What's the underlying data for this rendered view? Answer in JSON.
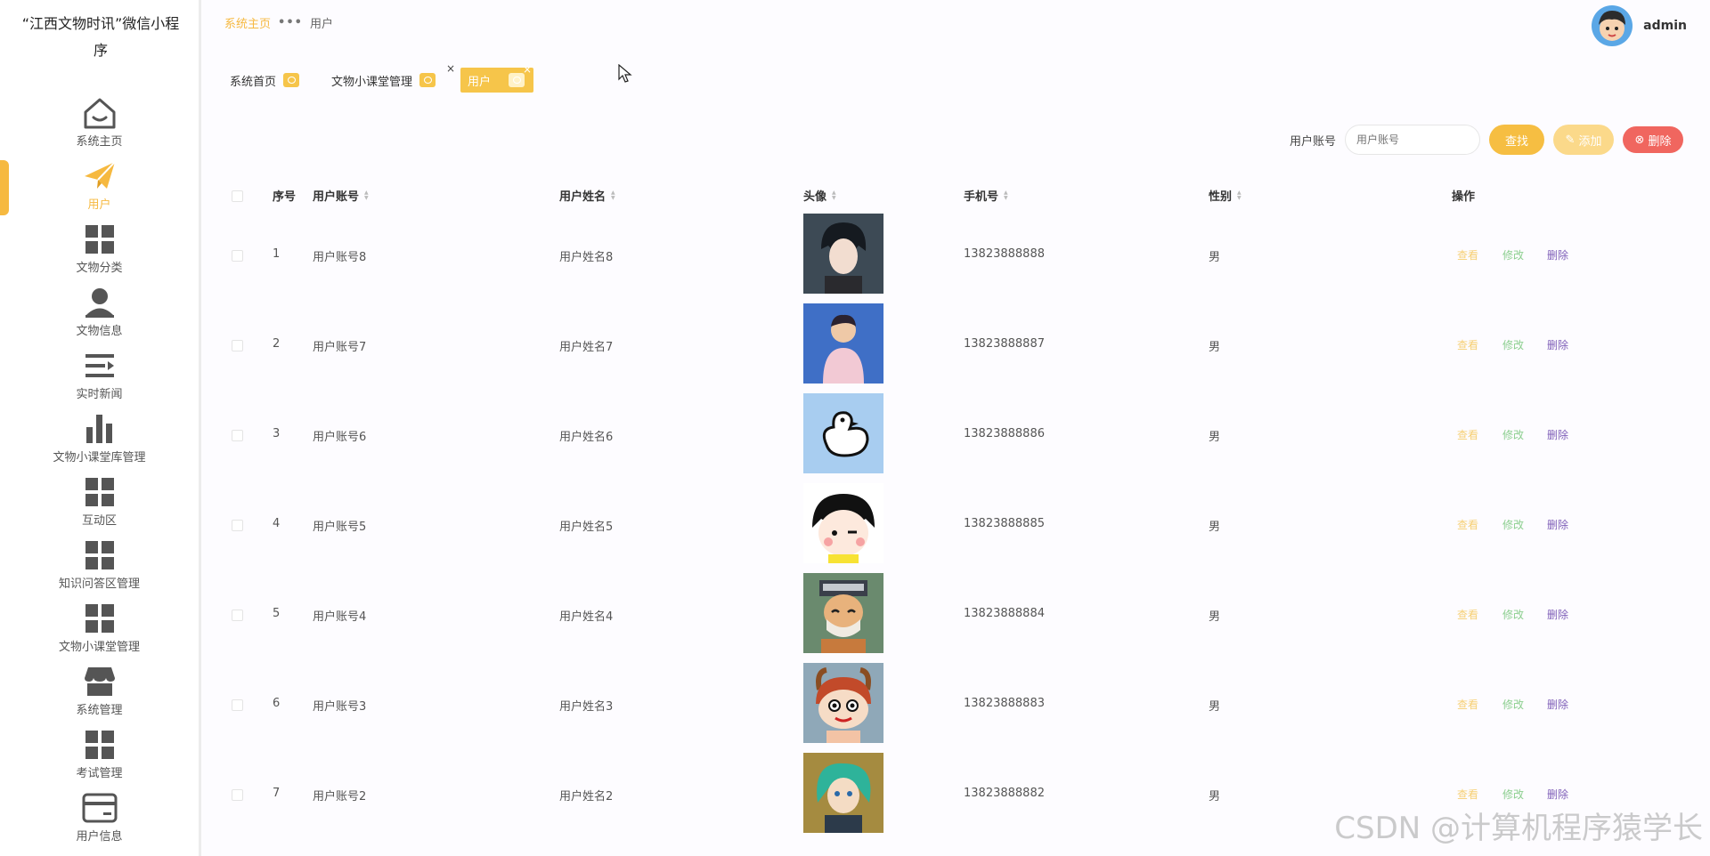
{
  "app": {
    "title": "“江西文物时讯”微信小程序"
  },
  "sidebar": {
    "items": [
      {
        "label": "系统主页",
        "icon": "home-icon"
      },
      {
        "label": "用户",
        "icon": "paper-plane-icon",
        "active": true
      },
      {
        "label": "文物分类",
        "icon": "grid-icon"
      },
      {
        "label": "文物信息",
        "icon": "person-icon"
      },
      {
        "label": "实时新闻",
        "icon": "list-icon"
      },
      {
        "label": "文物小课堂库管理",
        "icon": "bar-chart-icon"
      },
      {
        "label": "互动区",
        "icon": "grid-icon"
      },
      {
        "label": "知识问答区管理",
        "icon": "grid-icon"
      },
      {
        "label": "文物小课堂管理",
        "icon": "grid-icon"
      },
      {
        "label": "系统管理",
        "icon": "store-icon"
      },
      {
        "label": "考试管理",
        "icon": "grid-icon"
      },
      {
        "label": "用户信息",
        "icon": "card-icon"
      }
    ]
  },
  "header": {
    "breadcrumb": {
      "home": "系统主页",
      "sep": "•••",
      "current": "用户"
    },
    "username": "admin"
  },
  "tabs": [
    {
      "label": "系统首页"
    },
    {
      "label": "文物小课堂管理",
      "close": "×"
    },
    {
      "label": "用户",
      "close": "×",
      "active": true
    }
  ],
  "search": {
    "label": "用户账号",
    "placeholder": "用户账号",
    "search_btn": "查找",
    "add_btn": "添加",
    "delete_btn": "删除"
  },
  "table": {
    "columns": {
      "index": "序号",
      "account": "用户账号",
      "name": "用户姓名",
      "avatar": "头像",
      "phone": "手机号",
      "gender": "性别",
      "actions": "操作"
    },
    "actions": {
      "view": "查看",
      "edit": "修改",
      "delete": "删除"
    },
    "rows": [
      {
        "index": "1",
        "account": "用户账号8",
        "name": "用户姓名8",
        "phone": "13823888888",
        "gender": "男"
      },
      {
        "index": "2",
        "account": "用户账号7",
        "name": "用户姓名7",
        "phone": "13823888887",
        "gender": "男"
      },
      {
        "index": "3",
        "account": "用户账号6",
        "name": "用户姓名6",
        "phone": "13823888886",
        "gender": "男"
      },
      {
        "index": "4",
        "account": "用户账号5",
        "name": "用户姓名5",
        "phone": "13823888885",
        "gender": "男"
      },
      {
        "index": "5",
        "account": "用户账号4",
        "name": "用户姓名4",
        "phone": "13823888884",
        "gender": "男"
      },
      {
        "index": "6",
        "account": "用户账号3",
        "name": "用户姓名3",
        "phone": "13823888883",
        "gender": "男"
      },
      {
        "index": "7",
        "account": "用户账号2",
        "name": "用户姓名2",
        "phone": "13823888882",
        "gender": "男"
      }
    ]
  },
  "colors": {
    "accent": "#f6be42",
    "danger": "#f0665f",
    "edit": "#8ccf8f",
    "delete_link": "#7f5fb8"
  },
  "watermark": "CSDN @计算机程序猿学长"
}
